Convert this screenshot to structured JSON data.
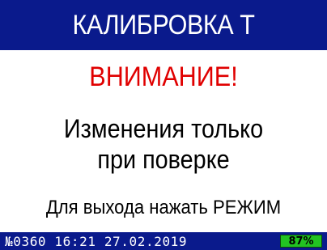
{
  "header": {
    "title": "КАЛИБРОВКА Т"
  },
  "main": {
    "warning": "ВНИМАНИЕ!",
    "message_line1": "Изменения только",
    "message_line2": "при поверке",
    "exit_hint": "Для выхода нажать РЕЖИМ"
  },
  "status_bar": {
    "device_number": "№0360",
    "time": "16:21",
    "date": "27.02.2019",
    "battery_label": "87%",
    "battery_level": 0.87
  },
  "colors": {
    "header_bg": "#0a1a8c",
    "warning": "#e00000",
    "battery": "#22c322"
  }
}
